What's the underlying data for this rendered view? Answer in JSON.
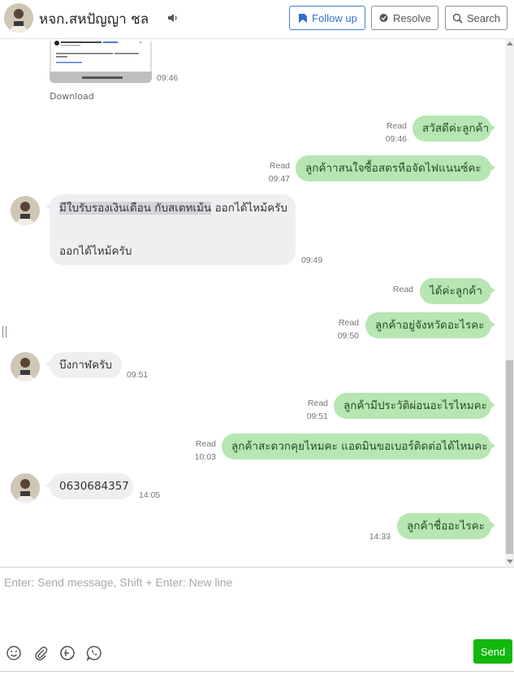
{
  "header": {
    "name": "หจก.สหปัญญา ชล",
    "follow_label": "Follow up",
    "resolve_label": "Resolve",
    "search_label": "Search"
  },
  "messages": {
    "download_label": "Download",
    "media_time": "09:46",
    "m1": {
      "text": "สวัสดีค่ะลูกค้า",
      "status": "Read",
      "time": "09:46"
    },
    "m2": {
      "text": "ลูกค้าาสนใจซื้อสตรหือจัดไฟแนนซ์คะ",
      "status": "Read",
      "time": "09:47"
    },
    "m3": {
      "highlight": "มีใบรับรองเงินเดือน กับสเตทเม้น",
      "text_after": " ออกได้ไหม้ครับ",
      "line2": "ออกได้ไหม้ครับ",
      "time": "09:49"
    },
    "m4": {
      "text": "ได้ค่ะลูกค้า",
      "status": "Read"
    },
    "m5": {
      "text": "ลูกค้าอยู่จังหวัดอะไรคะ",
      "status": "Read",
      "time": "09:50"
    },
    "m6": {
      "text": "บึงกาฬครับ",
      "time": "09:51"
    },
    "m7": {
      "text": "ลูกค้ามีประวัติผ่อนอะไรไหมคะ",
      "status": "Read",
      "time": "09:51"
    },
    "m8": {
      "text": "ลูกค้าสะดวกคุยไหมคะ แอดมินขอเบอร์ติดต่อได้ไหมคะ",
      "status": "Read",
      "time": "10:03"
    },
    "m9": {
      "text": "0630684357",
      "time": "14:05"
    },
    "m10": {
      "text": "ลูกค้าชื่ออะไรคะ",
      "time": "14:33"
    }
  },
  "composer": {
    "placeholder": "Enter: Send message, Shift + Enter: New line",
    "send_label": "Send"
  }
}
